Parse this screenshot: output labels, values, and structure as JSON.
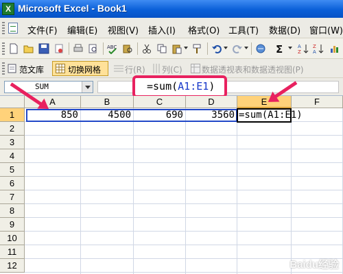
{
  "window": {
    "title": "Microsoft Excel - Book1",
    "app_icon": "X"
  },
  "menu": [
    "文件(F)",
    "编辑(E)",
    "视图(V)",
    "插入(I)",
    "格式(O)",
    "工具(T)",
    "数据(D)",
    "窗口(W)"
  ],
  "toolbar2": {
    "library": "范文库",
    "switch_grid": "切换网格",
    "row": "行(R)",
    "col": "列(C)",
    "pivot": "数据透视表和数据透视图(P)"
  },
  "namebox": {
    "value": "SUM"
  },
  "formula": {
    "prefix": "=sum(",
    "ref": "A1:E1",
    "suffix": ")"
  },
  "columns": [
    "A",
    "B",
    "C",
    "D",
    "E",
    "F"
  ],
  "rows": [
    "1",
    "2",
    "3",
    "4",
    "5",
    "6",
    "7",
    "8",
    "9",
    "10",
    "11",
    "12"
  ],
  "cells": {
    "A1": "850",
    "B1": "4500",
    "C1": "690",
    "D1": "3560",
    "E1": "=sum(A1:E1)"
  },
  "colors": {
    "callout": "#e8215f",
    "range": "#2047c8",
    "active_header": "#ffd27a"
  },
  "watermark": "Baidu经验"
}
